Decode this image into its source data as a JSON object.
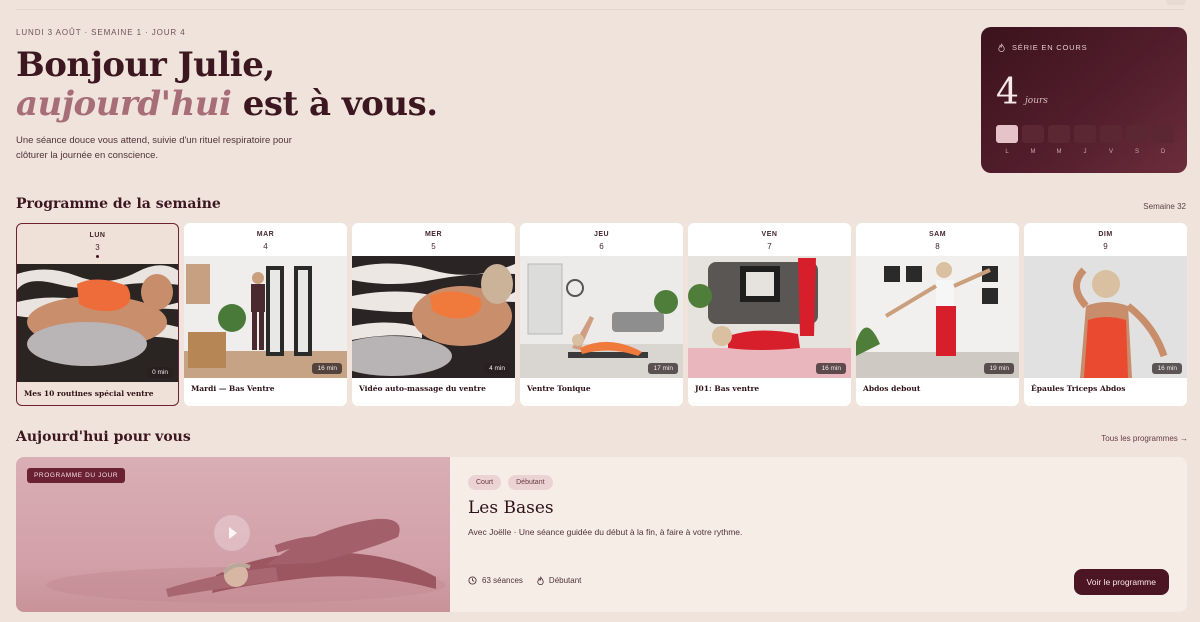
{
  "header": {
    "eyebrow": "LUNDI 3 AOÛT · SEMAINE 1 · JOUR 4",
    "greeting": "Bonjour Julie,",
    "subtitle_accent": "aujourd'hui",
    "subtitle_rest": " est à vous.",
    "description": "Une séance douce vous attend, suivie d'un rituel respiratoire pour clôturer la journée en conscience."
  },
  "streak": {
    "label": "SÉRIE EN COURS",
    "count": "4",
    "unit": "jours",
    "days": [
      {
        "letter": "L",
        "done": true
      },
      {
        "letter": "M",
        "done": false
      },
      {
        "letter": "M",
        "done": false
      },
      {
        "letter": "J",
        "done": false
      },
      {
        "letter": "V",
        "done": false
      },
      {
        "letter": "S",
        "done": false
      },
      {
        "letter": "D",
        "done": false
      }
    ]
  },
  "week": {
    "title": "Programme de la semaine",
    "meta": "Semaine 32",
    "days": [
      {
        "dow": "LUN",
        "num": "3",
        "duration": "0 min",
        "title": "Mes 10 routines spécial ventre",
        "active": true
      },
      {
        "dow": "MAR",
        "num": "4",
        "duration": "16 min",
        "title": "Mardi — Bas Ventre",
        "active": false
      },
      {
        "dow": "MER",
        "num": "5",
        "duration": "4 min",
        "title": "Vidéo auto-massage du ventre",
        "active": false
      },
      {
        "dow": "JEU",
        "num": "6",
        "duration": "17 min",
        "title": "Ventre Tonique",
        "active": false
      },
      {
        "dow": "VEN",
        "num": "7",
        "duration": "16 min",
        "title": "J01: Bas ventre",
        "active": false
      },
      {
        "dow": "SAM",
        "num": "8",
        "duration": "19 min",
        "title": "Abdos debout",
        "active": false
      },
      {
        "dow": "DIM",
        "num": "9",
        "duration": "16 min",
        "title": "Épaules Triceps Abdos",
        "active": false
      }
    ]
  },
  "today": {
    "title": "Aujourd'hui pour vous",
    "link": "Tous les programmes →",
    "badge": "PROGRAMME DU JOUR",
    "tags": [
      "Court",
      "Débutant"
    ],
    "program_title": "Les Bases",
    "description": "Avec Joëlle · Une séance guidée du début à la fin, à faire à votre rythme.",
    "sessions": "63 séances",
    "level": "Débutant",
    "cta": "Voir le programme"
  }
}
